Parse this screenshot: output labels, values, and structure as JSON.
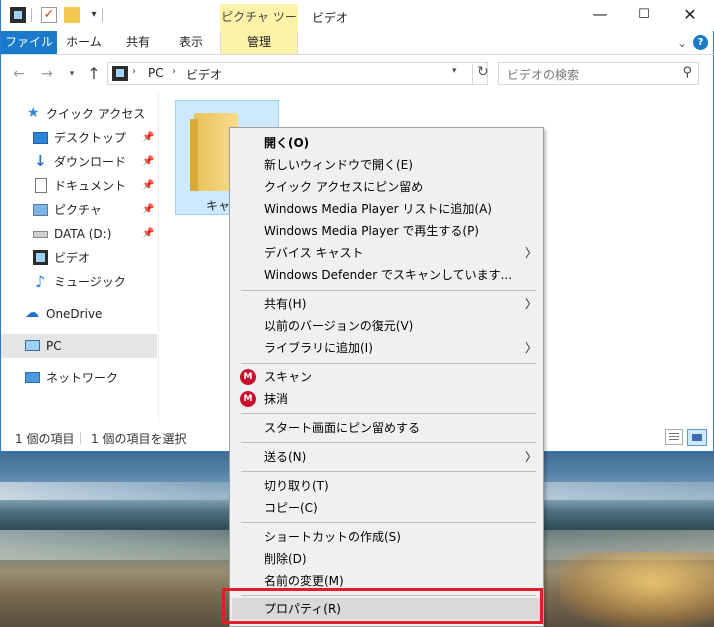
{
  "window": {
    "title": "ビデオ",
    "contextual_tab_header": "ピクチャ ツール",
    "quick_access_toolbar": {
      "icons": [
        "film-icon",
        "checkmark-icon",
        "folder-icon",
        "dropdown-icon"
      ]
    },
    "controls": {
      "minimize": "—",
      "maximize": "☐",
      "close": "✕"
    }
  },
  "ribbon": {
    "tabs": [
      "ファイル",
      "ホーム",
      "共有",
      "表示",
      "管理"
    ],
    "expand_glyph": "⌄",
    "help_glyph": "?"
  },
  "address_bar": {
    "crumbs": [
      "PC",
      "ビデオ"
    ],
    "search_placeholder": "ビデオの検索"
  },
  "nav_pane": {
    "items": [
      {
        "label": "クイック アクセス",
        "icon": "star-icon",
        "pinned": false
      },
      {
        "label": "デスクトップ",
        "icon": "desktop-icon",
        "pinned": true
      },
      {
        "label": "ダウンロード",
        "icon": "download-icon",
        "pinned": true
      },
      {
        "label": "ドキュメント",
        "icon": "document-icon",
        "pinned": true
      },
      {
        "label": "ピクチャ",
        "icon": "pictures-icon",
        "pinned": true
      },
      {
        "label": "DATA (D:)",
        "icon": "drive-icon",
        "pinned": true
      },
      {
        "label": "ビデオ",
        "icon": "video-icon",
        "pinned": false
      },
      {
        "label": "ミュージック",
        "icon": "music-icon",
        "pinned": false
      },
      {
        "label": "OneDrive",
        "icon": "onedrive-icon",
        "pinned": false
      },
      {
        "label": "PC",
        "icon": "pc-icon",
        "pinned": false,
        "selected": true
      },
      {
        "label": "ネットワーク",
        "icon": "network-icon",
        "pinned": false
      }
    ]
  },
  "content": {
    "folder_label": "キャプ"
  },
  "status_bar": {
    "item_count": "1 個の項目",
    "selected_count": "1 個の項目を選択"
  },
  "context_menu": {
    "items": [
      {
        "label": "開く(O)",
        "bold": true
      },
      {
        "label": "新しいウィンドウで開く(E)"
      },
      {
        "label": "クイック アクセスにピン留め"
      },
      {
        "label": "Windows Media Player リストに追加(A)"
      },
      {
        "label": "Windows Media Player で再生する(P)"
      },
      {
        "label": "デバイス キャスト",
        "submenu": true
      },
      {
        "label": "Windows Defender でスキャンしています..."
      },
      {
        "label": "共有(H)",
        "submenu": true
      },
      {
        "label": "以前のバージョンの復元(V)"
      },
      {
        "label": "ライブラリに追加(I)",
        "submenu": true
      },
      {
        "label": "スキャン",
        "icon": "mcafee-icon"
      },
      {
        "label": "抹消",
        "icon": "mcafee-icon"
      },
      {
        "label": "スタート画面にピン留めする"
      },
      {
        "label": "送る(N)",
        "submenu": true
      },
      {
        "label": "切り取り(T)"
      },
      {
        "label": "コピー(C)"
      },
      {
        "label": "ショートカットの作成(S)"
      },
      {
        "label": "削除(D)"
      },
      {
        "label": "名前の変更(M)"
      },
      {
        "label": "プロパティ(R)",
        "highlighted": true
      }
    ],
    "submenu_arrow": "〉"
  },
  "colors": {
    "file_tab": "#1979ca",
    "contextual_tab": "#fdf3a8",
    "selection": "#cde8ff",
    "annotation_box": "#e01e2b"
  }
}
